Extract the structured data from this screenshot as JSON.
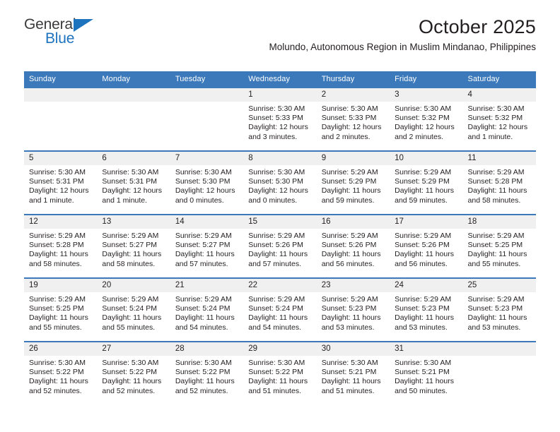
{
  "brand": {
    "name_top": "General",
    "name_bottom": "Blue",
    "accent_color": "#1e73be"
  },
  "header": {
    "month_title": "October 2025",
    "location": "Molundo, Autonomous Region in Muslim Mindanao, Philippines"
  },
  "calendar": {
    "header_color": "#3b79bb",
    "weekday_headers": [
      "Sunday",
      "Monday",
      "Tuesday",
      "Wednesday",
      "Thursday",
      "Friday",
      "Saturday"
    ],
    "weeks": [
      [
        {
          "day": ""
        },
        {
          "day": ""
        },
        {
          "day": ""
        },
        {
          "day": "1",
          "sunrise": "Sunrise: 5:30 AM",
          "sunset": "Sunset: 5:33 PM",
          "daylight1": "Daylight: 12 hours",
          "daylight2": "and 3 minutes."
        },
        {
          "day": "2",
          "sunrise": "Sunrise: 5:30 AM",
          "sunset": "Sunset: 5:33 PM",
          "daylight1": "Daylight: 12 hours",
          "daylight2": "and 2 minutes."
        },
        {
          "day": "3",
          "sunrise": "Sunrise: 5:30 AM",
          "sunset": "Sunset: 5:32 PM",
          "daylight1": "Daylight: 12 hours",
          "daylight2": "and 2 minutes."
        },
        {
          "day": "4",
          "sunrise": "Sunrise: 5:30 AM",
          "sunset": "Sunset: 5:32 PM",
          "daylight1": "Daylight: 12 hours",
          "daylight2": "and 1 minute."
        }
      ],
      [
        {
          "day": "5",
          "sunrise": "Sunrise: 5:30 AM",
          "sunset": "Sunset: 5:31 PM",
          "daylight1": "Daylight: 12 hours",
          "daylight2": "and 1 minute."
        },
        {
          "day": "6",
          "sunrise": "Sunrise: 5:30 AM",
          "sunset": "Sunset: 5:31 PM",
          "daylight1": "Daylight: 12 hours",
          "daylight2": "and 1 minute."
        },
        {
          "day": "7",
          "sunrise": "Sunrise: 5:30 AM",
          "sunset": "Sunset: 5:30 PM",
          "daylight1": "Daylight: 12 hours",
          "daylight2": "and 0 minutes."
        },
        {
          "day": "8",
          "sunrise": "Sunrise: 5:30 AM",
          "sunset": "Sunset: 5:30 PM",
          "daylight1": "Daylight: 12 hours",
          "daylight2": "and 0 minutes."
        },
        {
          "day": "9",
          "sunrise": "Sunrise: 5:29 AM",
          "sunset": "Sunset: 5:29 PM",
          "daylight1": "Daylight: 11 hours",
          "daylight2": "and 59 minutes."
        },
        {
          "day": "10",
          "sunrise": "Sunrise: 5:29 AM",
          "sunset": "Sunset: 5:29 PM",
          "daylight1": "Daylight: 11 hours",
          "daylight2": "and 59 minutes."
        },
        {
          "day": "11",
          "sunrise": "Sunrise: 5:29 AM",
          "sunset": "Sunset: 5:28 PM",
          "daylight1": "Daylight: 11 hours",
          "daylight2": "and 58 minutes."
        }
      ],
      [
        {
          "day": "12",
          "sunrise": "Sunrise: 5:29 AM",
          "sunset": "Sunset: 5:28 PM",
          "daylight1": "Daylight: 11 hours",
          "daylight2": "and 58 minutes."
        },
        {
          "day": "13",
          "sunrise": "Sunrise: 5:29 AM",
          "sunset": "Sunset: 5:27 PM",
          "daylight1": "Daylight: 11 hours",
          "daylight2": "and 58 minutes."
        },
        {
          "day": "14",
          "sunrise": "Sunrise: 5:29 AM",
          "sunset": "Sunset: 5:27 PM",
          "daylight1": "Daylight: 11 hours",
          "daylight2": "and 57 minutes."
        },
        {
          "day": "15",
          "sunrise": "Sunrise: 5:29 AM",
          "sunset": "Sunset: 5:26 PM",
          "daylight1": "Daylight: 11 hours",
          "daylight2": "and 57 minutes."
        },
        {
          "day": "16",
          "sunrise": "Sunrise: 5:29 AM",
          "sunset": "Sunset: 5:26 PM",
          "daylight1": "Daylight: 11 hours",
          "daylight2": "and 56 minutes."
        },
        {
          "day": "17",
          "sunrise": "Sunrise: 5:29 AM",
          "sunset": "Sunset: 5:26 PM",
          "daylight1": "Daylight: 11 hours",
          "daylight2": "and 56 minutes."
        },
        {
          "day": "18",
          "sunrise": "Sunrise: 5:29 AM",
          "sunset": "Sunset: 5:25 PM",
          "daylight1": "Daylight: 11 hours",
          "daylight2": "and 55 minutes."
        }
      ],
      [
        {
          "day": "19",
          "sunrise": "Sunrise: 5:29 AM",
          "sunset": "Sunset: 5:25 PM",
          "daylight1": "Daylight: 11 hours",
          "daylight2": "and 55 minutes."
        },
        {
          "day": "20",
          "sunrise": "Sunrise: 5:29 AM",
          "sunset": "Sunset: 5:24 PM",
          "daylight1": "Daylight: 11 hours",
          "daylight2": "and 55 minutes."
        },
        {
          "day": "21",
          "sunrise": "Sunrise: 5:29 AM",
          "sunset": "Sunset: 5:24 PM",
          "daylight1": "Daylight: 11 hours",
          "daylight2": "and 54 minutes."
        },
        {
          "day": "22",
          "sunrise": "Sunrise: 5:29 AM",
          "sunset": "Sunset: 5:24 PM",
          "daylight1": "Daylight: 11 hours",
          "daylight2": "and 54 minutes."
        },
        {
          "day": "23",
          "sunrise": "Sunrise: 5:29 AM",
          "sunset": "Sunset: 5:23 PM",
          "daylight1": "Daylight: 11 hours",
          "daylight2": "and 53 minutes."
        },
        {
          "day": "24",
          "sunrise": "Sunrise: 5:29 AM",
          "sunset": "Sunset: 5:23 PM",
          "daylight1": "Daylight: 11 hours",
          "daylight2": "and 53 minutes."
        },
        {
          "day": "25",
          "sunrise": "Sunrise: 5:29 AM",
          "sunset": "Sunset: 5:23 PM",
          "daylight1": "Daylight: 11 hours",
          "daylight2": "and 53 minutes."
        }
      ],
      [
        {
          "day": "26",
          "sunrise": "Sunrise: 5:30 AM",
          "sunset": "Sunset: 5:22 PM",
          "daylight1": "Daylight: 11 hours",
          "daylight2": "and 52 minutes."
        },
        {
          "day": "27",
          "sunrise": "Sunrise: 5:30 AM",
          "sunset": "Sunset: 5:22 PM",
          "daylight1": "Daylight: 11 hours",
          "daylight2": "and 52 minutes."
        },
        {
          "day": "28",
          "sunrise": "Sunrise: 5:30 AM",
          "sunset": "Sunset: 5:22 PM",
          "daylight1": "Daylight: 11 hours",
          "daylight2": "and 52 minutes."
        },
        {
          "day": "29",
          "sunrise": "Sunrise: 5:30 AM",
          "sunset": "Sunset: 5:22 PM",
          "daylight1": "Daylight: 11 hours",
          "daylight2": "and 51 minutes."
        },
        {
          "day": "30",
          "sunrise": "Sunrise: 5:30 AM",
          "sunset": "Sunset: 5:21 PM",
          "daylight1": "Daylight: 11 hours",
          "daylight2": "and 51 minutes."
        },
        {
          "day": "31",
          "sunrise": "Sunrise: 5:30 AM",
          "sunset": "Sunset: 5:21 PM",
          "daylight1": "Daylight: 11 hours",
          "daylight2": "and 50 minutes."
        },
        {
          "day": ""
        }
      ]
    ]
  }
}
